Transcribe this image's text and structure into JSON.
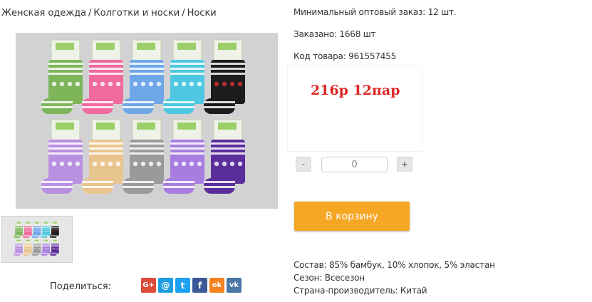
{
  "breadcrumb": {
    "items": [
      "Женская одежда",
      "Колготки и носки",
      "Носки"
    ],
    "separator": "/"
  },
  "product": {
    "min_order": "Минимальный оптовый заказ: 12 шт.",
    "ordered": "Заказано: 1668 шт",
    "sku": "Код товара: 961557455",
    "price": "216р 12пар",
    "qty_minus": "-",
    "qty_plus": "+",
    "qty_value": "0",
    "cart_button": "В корзину",
    "composition": "Состав: 85% бамбук, 10% хлопок, 5% эластан",
    "season": "Сезон: Всесезон",
    "country": "Страна-производитель: Китай"
  },
  "share": {
    "label": "Поделиться:",
    "buttons": [
      {
        "icon": "google-plus-icon",
        "glyph": "G+",
        "color": "#dd4b39"
      },
      {
        "icon": "email-icon",
        "glyph": "@",
        "color": "#1e9ee0"
      },
      {
        "icon": "twitter-icon",
        "glyph": "t",
        "color": "#1da1f2"
      },
      {
        "icon": "facebook-icon",
        "glyph": "f",
        "color": "#3b5998"
      },
      {
        "icon": "odnoklassniki-icon",
        "glyph": "ok",
        "color": "#f58220"
      },
      {
        "icon": "vk-icon",
        "glyph": "vk",
        "color": "#4a76a8"
      }
    ]
  },
  "colors": {
    "price": "#e02424",
    "cart_button": "#f5a623",
    "sock_colors_top": [
      "#7fb55a",
      "#f06a9c",
      "#6fa6e8",
      "#4ec8e0",
      "#1c1c1c"
    ],
    "sock_colors_bottom": [
      "#b98fe0",
      "#e8c48e",
      "#9a9a9a",
      "#a77ee0",
      "#5b2d9a"
    ]
  }
}
